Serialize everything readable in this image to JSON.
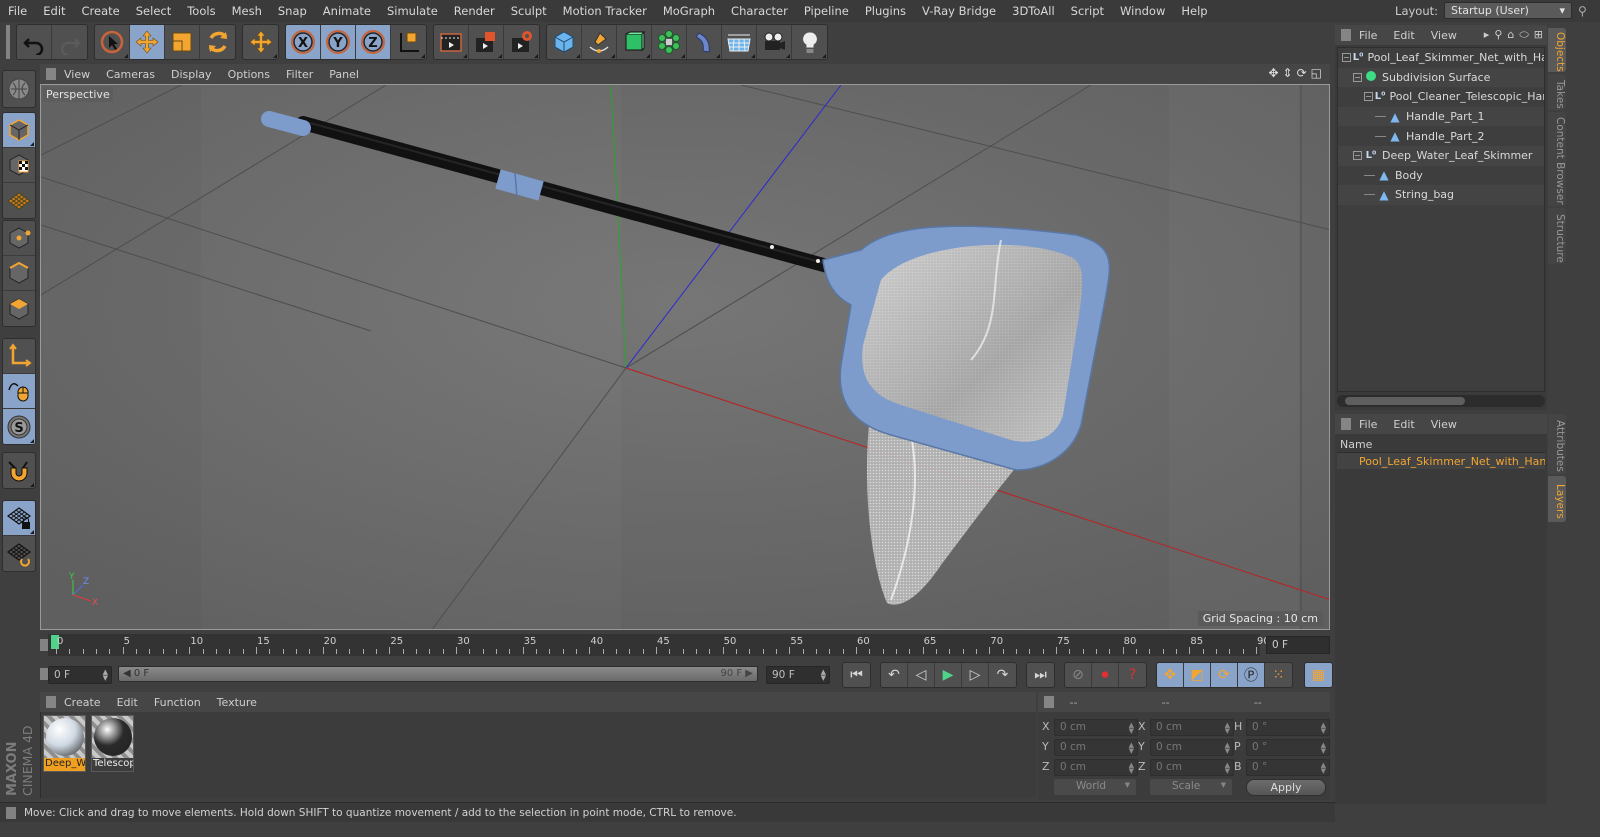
{
  "menubar": {
    "items": [
      "File",
      "Edit",
      "Create",
      "Select",
      "Tools",
      "Mesh",
      "Snap",
      "Animate",
      "Simulate",
      "Render",
      "Sculpt",
      "Motion Tracker",
      "MoGraph",
      "Character",
      "Pipeline",
      "Plugins",
      "V-Ray Bridge",
      "3DToAll",
      "Script",
      "Window",
      "Help"
    ],
    "layout_label": "Layout:",
    "layout_value": "Startup (User)"
  },
  "toolbar": {
    "groups": [
      [
        {
          "icon": "undo-icon"
        },
        {
          "icon": "redo-icon"
        }
      ],
      [
        {
          "icon": "live-selection-icon"
        },
        {
          "icon": "move-icon",
          "active": true
        },
        {
          "icon": "scale-icon"
        },
        {
          "icon": "rotate-icon"
        }
      ],
      [
        {
          "icon": "last-tool-icon"
        }
      ],
      [
        {
          "icon": "x-axis-lock-icon",
          "active": true
        },
        {
          "icon": "y-axis-lock-icon",
          "active": true
        },
        {
          "icon": "z-axis-lock-icon",
          "active": true
        },
        {
          "icon": "coordinate-system-icon"
        }
      ],
      [
        {
          "icon": "render-view-icon"
        },
        {
          "icon": "render-picture-viewer-icon"
        },
        {
          "icon": "render-settings-icon"
        }
      ],
      [
        {
          "icon": "cube-primitive-icon"
        },
        {
          "icon": "pen-spline-icon"
        },
        {
          "icon": "subdivision-surface-icon"
        },
        {
          "icon": "cloner-icon"
        },
        {
          "icon": "bend-deformer-icon"
        },
        {
          "icon": "floor-icon"
        },
        {
          "icon": "camera-icon"
        },
        {
          "icon": "light-icon"
        }
      ]
    ]
  },
  "lefttools": {
    "items": [
      "make-editable-icon",
      "model-mode-icon",
      "texture-mode-icon",
      "workplane-mode-icon",
      "points-mode-icon",
      "edges-mode-icon",
      "polygons-mode-icon",
      "axis-mode-icon",
      "tweak-mode-icon",
      "solo-icon",
      "snap-magnet-icon",
      "lock-workplane-icon",
      "align-workplane-icon"
    ]
  },
  "viewport": {
    "menus": [
      "View",
      "Cameras",
      "Display",
      "Options",
      "Filter",
      "Panel"
    ],
    "label": "Perspective",
    "grid_spacing": "Grid Spacing : 10 cm",
    "axis_labels": {
      "y": "Y",
      "z": "Z",
      "x": "X"
    }
  },
  "timeline": {
    "start": 0,
    "end": 90,
    "major_step": 5,
    "current_frame": 0,
    "current_field": "0 F"
  },
  "transport": {
    "start_field": "0 F",
    "range_left": "0 F",
    "range_right": "90 F",
    "end_field": "90 F"
  },
  "materials": {
    "menus": [
      "Create",
      "Edit",
      "Function",
      "Texture"
    ],
    "items": [
      {
        "name": "Deep_W",
        "selected": true,
        "color": "#cfd8e2"
      },
      {
        "name": "Telescop",
        "selected": false,
        "color": "#2a2a2a"
      }
    ]
  },
  "brand": {
    "maxon": "MAXON",
    "product": "CINEMA 4D"
  },
  "coords": {
    "headers": [
      "--",
      "--",
      "--"
    ],
    "rows": [
      {
        "pos_label": "X",
        "pos": "0 cm",
        "scale_label": "X",
        "scale": "0 cm",
        "rot_label": "H",
        "rot": "0 °"
      },
      {
        "pos_label": "Y",
        "pos": "0 cm",
        "scale_label": "Y",
        "scale": "0 cm",
        "rot_label": "P",
        "rot": "0 °"
      },
      {
        "pos_label": "Z",
        "pos": "0 cm",
        "scale_label": "Z",
        "scale": "0 cm",
        "rot_label": "B",
        "rot": "0 °"
      }
    ],
    "mode": "World",
    "scale_mode": "Scale",
    "apply_label": "Apply"
  },
  "status": {
    "text": "Move: Click and drag to move elements. Hold down SHIFT to quantize movement / add to the selection in point mode, CTRL to remove."
  },
  "objects": {
    "menus": [
      "File",
      "Edit",
      "View"
    ],
    "tree": [
      {
        "name": "Pool_Leaf_Skimmer_Net_with_Handle",
        "type": "null",
        "depth": 0,
        "expandable": true
      },
      {
        "name": "Subdivision Surface",
        "type": "subdivision",
        "depth": 1,
        "expandable": true
      },
      {
        "name": "Pool_Cleaner_Telescopic_Handle",
        "type": "null",
        "depth": 2,
        "expandable": true
      },
      {
        "name": "Handle_Part_1",
        "type": "polygon",
        "depth": 3,
        "expandable": false
      },
      {
        "name": "Handle_Part_2",
        "type": "polygon",
        "depth": 3,
        "expandable": false
      },
      {
        "name": "Deep_Water_Leaf_Skimmer",
        "type": "null",
        "depth": 1,
        "expandable": true
      },
      {
        "name": "Body",
        "type": "polygon",
        "depth": 2,
        "expandable": false
      },
      {
        "name": "String_bag",
        "type": "polygon",
        "depth": 2,
        "expandable": false
      }
    ]
  },
  "layers": {
    "menus": [
      "File",
      "Edit",
      "View"
    ],
    "column": "Name",
    "rows": [
      {
        "name": "Pool_Leaf_Skimmer_Net_with_Handle",
        "color": "#d5702c"
      }
    ]
  },
  "side_tabs": {
    "top": [
      {
        "label": "Objects",
        "active": true
      },
      {
        "label": "Takes"
      },
      {
        "label": "Content Browser"
      },
      {
        "label": "Structure"
      }
    ],
    "bottom": [
      {
        "label": "Attributes"
      },
      {
        "label": "Layers",
        "active": true
      }
    ]
  },
  "colors": {
    "accent": "#f2a531",
    "active_button": "#8aa3c9",
    "playhead": "#4fd38a",
    "net_frame": "#7d9ccc"
  }
}
